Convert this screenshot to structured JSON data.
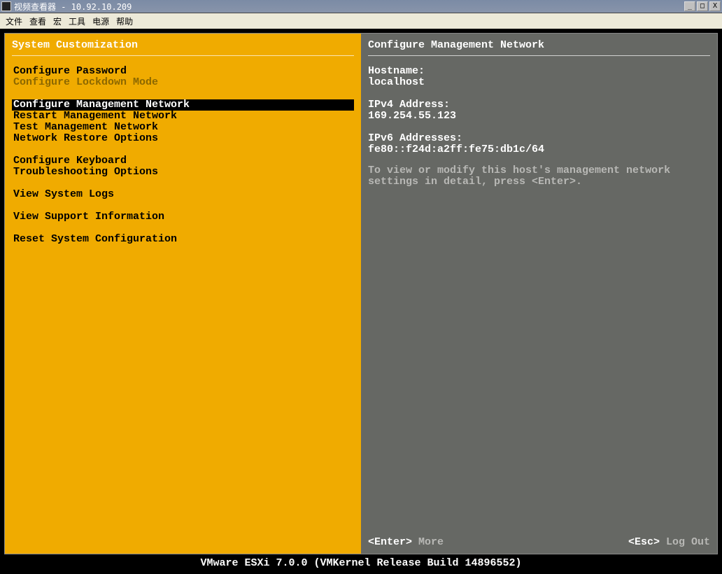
{
  "window": {
    "title": "视频查看器 - 10.92.10.209",
    "minimize": "_",
    "maximize": "□",
    "close": "X"
  },
  "menubar": {
    "file": "文件",
    "view": "查看",
    "macro": "宏",
    "tools": "工具",
    "power": "电源",
    "help": "帮助"
  },
  "left": {
    "title": "System Customization",
    "items": {
      "configure_password": "Configure Password",
      "configure_lockdown": "Configure Lockdown Mode",
      "configure_mgmt_network": "Configure Management Network",
      "restart_mgmt_network": "Restart Management Network",
      "test_mgmt_network": "Test Management Network",
      "network_restore": "Network Restore Options",
      "configure_keyboard": "Configure Keyboard",
      "troubleshooting": "Troubleshooting Options",
      "view_system_logs": "View System Logs",
      "view_support_info": "View Support Information",
      "reset_system_config": "Reset System Configuration"
    }
  },
  "right": {
    "title": "Configure Management Network",
    "hostname_label": "Hostname:",
    "hostname_value": "localhost",
    "ipv4_label": "IPv4 Address:",
    "ipv4_value": "169.254.55.123",
    "ipv6_label": "IPv6 Addresses:",
    "ipv6_value": "fe80::f24d:a2ff:fe75:db1c/64",
    "help": "To view or modify this host's management network settings in detail, press <Enter>.",
    "footer_enter_key": "<Enter>",
    "footer_enter_text": "More",
    "footer_esc_key": "<Esc>",
    "footer_esc_text": "Log Out"
  },
  "status": "VMware ESXi 7.0.0 (VMKernel Release Build 14896552)"
}
